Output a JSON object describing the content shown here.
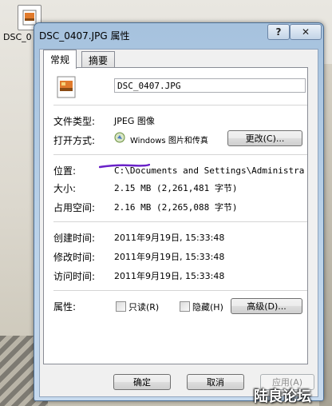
{
  "desktop": {
    "icon_label": "DSC_0"
  },
  "window": {
    "title": "DSC_0407.JPG 属性",
    "help_glyph": "?",
    "close_glyph": "✕"
  },
  "tabs": [
    {
      "label": "常规",
      "active": true
    },
    {
      "label": "摘要",
      "active": false
    }
  ],
  "general": {
    "file_name": "DSC_0407.JPG",
    "file_type_label": "文件类型:",
    "file_type_value": "JPEG 图像",
    "open_with_label": "打开方式:",
    "open_with_value": "Windows 图片和传真",
    "change_button": "更改(C)...",
    "location_label": "位置:",
    "location_value": "C:\\Documents and Settings\\Administrator\\桌",
    "size_label": "大小:",
    "size_value": "2.15 MB (2,261,481 字节)",
    "size_on_disk_label": "占用空间:",
    "size_on_disk_value": "2.16 MB (2,265,088 字节)",
    "created_label": "创建时间:",
    "created_value": "2011年9月19日, 15:33:48",
    "modified_label": "修改时间:",
    "modified_value": "2011年9月19日, 15:33:48",
    "accessed_label": "访问时间:",
    "accessed_value": "2011年9月19日, 15:33:48",
    "attributes_label": "属性:",
    "readonly_label": "只读(R)",
    "hidden_label": "隐藏(H)",
    "advanced_button": "高级(D)..."
  },
  "footer": {
    "ok_button": "确定",
    "cancel_button": "取消",
    "apply_button": "应用(A)"
  },
  "watermark": "陆良论坛",
  "colors": {
    "annotation_underline": "#6a22c8"
  }
}
